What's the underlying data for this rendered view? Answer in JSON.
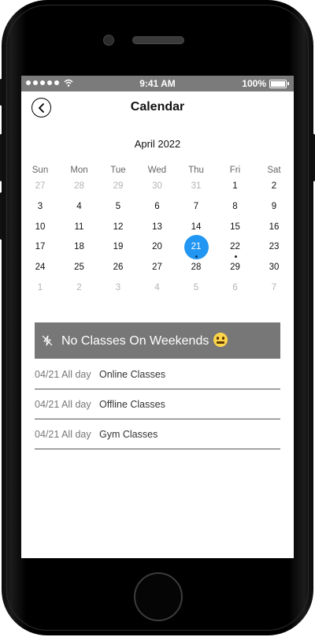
{
  "status_bar": {
    "time": "9:41 AM",
    "battery": "100%"
  },
  "header": {
    "title": "Calendar"
  },
  "calendar": {
    "month_label": "April 2022",
    "weekdays": [
      "Sun",
      "Mon",
      "Tue",
      "Wed",
      "Thu",
      "Fri",
      "Sat"
    ],
    "weeks": [
      [
        "27",
        "28",
        "29",
        "30",
        "31",
        "1",
        "2"
      ],
      [
        "3",
        "4",
        "5",
        "6",
        "7",
        "8",
        "9"
      ],
      [
        "10",
        "11",
        "12",
        "13",
        "14",
        "15",
        "16"
      ],
      [
        "17",
        "18",
        "19",
        "20",
        "21",
        "22",
        "23"
      ],
      [
        "24",
        "25",
        "26",
        "27",
        "28",
        "29",
        "30"
      ],
      [
        "1",
        "2",
        "3",
        "4",
        "5",
        "6",
        "7"
      ]
    ],
    "selected_day": "21",
    "event_days": [
      "21",
      "22"
    ]
  },
  "banner": {
    "text": "No Classes On Weekends",
    "icon": "no-lightning-icon"
  },
  "events": [
    {
      "date": "04/21",
      "time": "All day",
      "title": "Online Classes"
    },
    {
      "date": "04/21",
      "time": "All day",
      "title": "Offline Classes"
    },
    {
      "date": "04/21",
      "time": "All day",
      "title": "Gym Classes"
    }
  ],
  "colors": {
    "accent": "#2196f3",
    "banner_bg": "#777777",
    "status_bar_bg": "#7b7b7b"
  }
}
